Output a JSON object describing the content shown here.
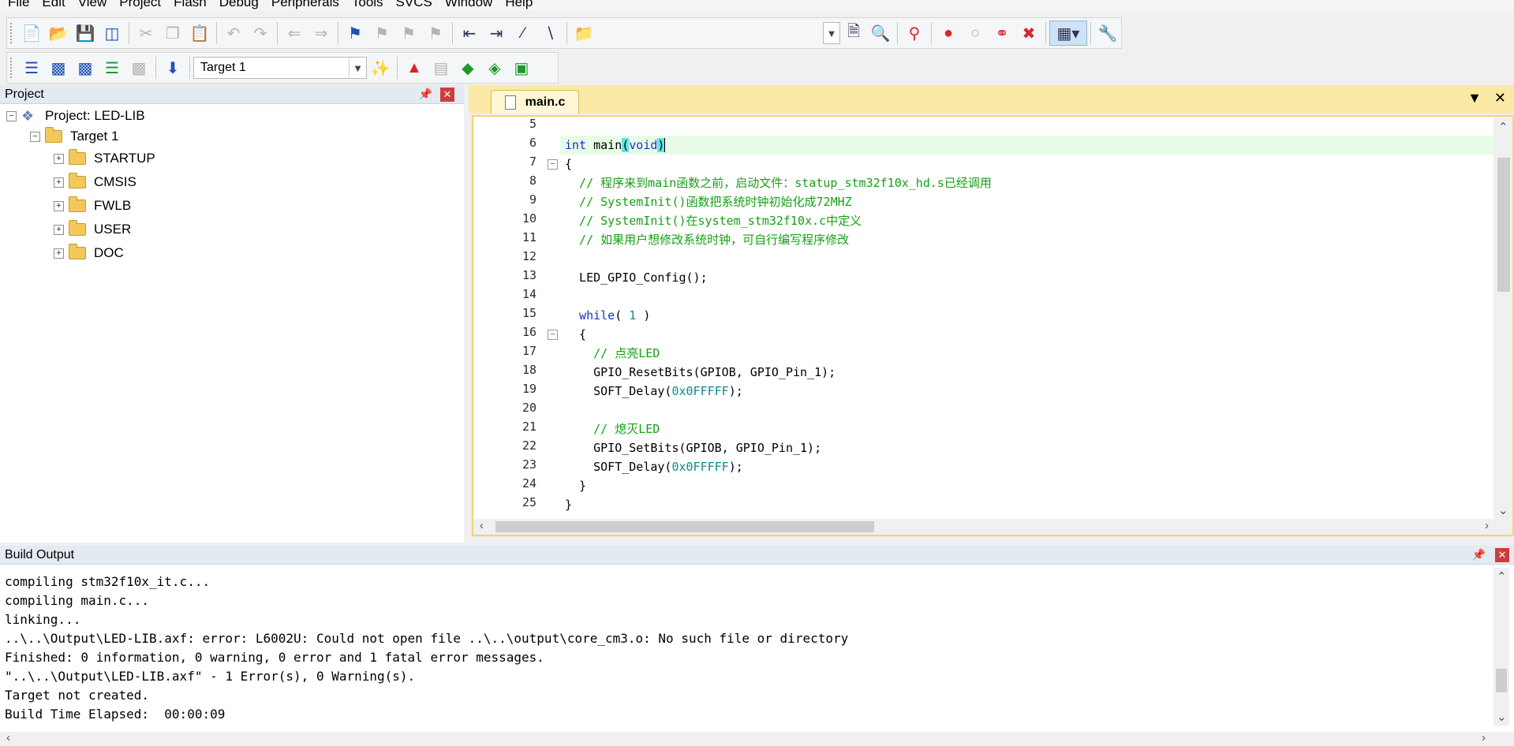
{
  "menu": [
    "File",
    "Edit",
    "View",
    "Project",
    "Flash",
    "Debug",
    "Peripherals",
    "Tools",
    "SVCS",
    "Window",
    "Help"
  ],
  "toolbar2": {
    "target_select": "Target 1"
  },
  "project_panel": {
    "title": "Project",
    "root": "Project: LED-LIB",
    "target": "Target 1",
    "groups": [
      "STARTUP",
      "CMSIS",
      "FWLB",
      "USER",
      "DOC"
    ]
  },
  "editor": {
    "tab": "main.c",
    "line_numbers": [
      "5",
      "6",
      "7",
      "8",
      "9",
      "10",
      "11",
      "12",
      "13",
      "14",
      "15",
      "16",
      "17",
      "18",
      "19",
      "20",
      "21",
      "22",
      "23",
      "24",
      "25"
    ],
    "lines": {
      "l6_kw1": "int",
      "l6_name": " main",
      "l6_paren_open": "(",
      "l6_void": "void",
      "l6_paren_close": ")",
      "l7": "{",
      "l8": "  // 程序来到main函数之前，启动文件：statup_stm32f10x_hd.s已经调用",
      "l9": "  // SystemInit()函数把系统时钟初始化成72MHZ",
      "l10": "  // SystemInit()在system_stm32f10x.c中定义",
      "l11": "  // 如果用户想修改系统时钟，可自行编写程序修改",
      "l13": "  LED_GPIO_Config();",
      "l15_kw": "  while",
      "l15_a": "( ",
      "l15_num": "1",
      "l15_b": " )",
      "l16": "  {",
      "l17": "    // 点亮LED",
      "l18": "    GPIO_ResetBits(GPIOB, GPIO_Pin_1);",
      "l19_a": "    SOFT_Delay(",
      "l19_num": "0x0FFFFF",
      "l19_b": ");",
      "l21": "    // 熄灭LED",
      "l22": "    GPIO_SetBits(GPIOB, GPIO_Pin_1);",
      "l23_a": "    SOFT_Delay(",
      "l23_num": "0x0FFFFF",
      "l23_b": ");",
      "l24": "  }",
      "l25": "}"
    }
  },
  "build_output": {
    "title": "Build Output",
    "lines": [
      "compiling stm32f10x_it.c...",
      "compiling main.c...",
      "linking...",
      "..\\..\\Output\\LED-LIB.axf: error: L6002U: Could not open file ..\\..\\output\\core_cm3.o: No such file or directory",
      "Finished: 0 information, 0 warning, 0 error and 1 fatal error messages.",
      "\"..\\..\\Output\\LED-LIB.axf\" - 1 Error(s), 0 Warning(s).",
      "Target not created.",
      "Build Time Elapsed:  00:00:09"
    ]
  }
}
